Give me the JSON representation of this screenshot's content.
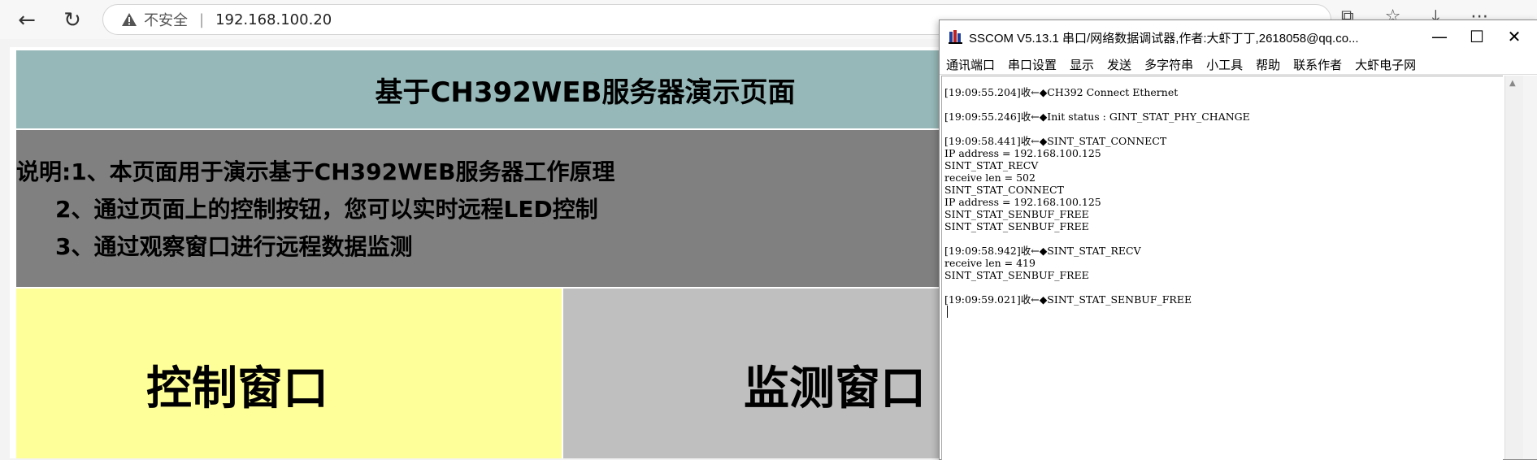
{
  "browser": {
    "back_icon": "←",
    "reload_icon": "↻",
    "insecure_label": "不安全",
    "url": "192.168.100.20"
  },
  "page": {
    "title": "基于CH392WEB服务器演示页面",
    "desc_lines": [
      "说明:1、本页面用于演示基于CH392WEB服务器工作原理",
      "2、通过页面上的控制按钮，您可以实时远程LED控制",
      "3、通过观察窗口进行远程数据监测"
    ],
    "control_title": "控制窗口",
    "monitor_title": "监测窗口",
    "colors": {
      "header": "#96b8b8",
      "desc": "#808080",
      "control": "#ffff99",
      "monitor": "#bfbfbf"
    }
  },
  "sscom": {
    "title": "SSCOM V5.13.1 串口/网络数据调试器,作者:大虾丁丁,2618058@qq.co...",
    "minimize": "—",
    "maximize": "☐",
    "close": "✕",
    "menu": [
      "通讯端口",
      "串口设置",
      "显示",
      "发送",
      "多字符串",
      "小工具",
      "帮助",
      "联系作者",
      "大虾电子网"
    ],
    "log": [
      [
        "[19:09:55.204]收←◆CH392 Connect Ethernet"
      ],
      [
        "[19:09:55.246]收←◆Init status : GINT_STAT_PHY_CHANGE"
      ],
      [
        "[19:09:58.441]收←◆SINT_STAT_CONNECT",
        "IP address = 192.168.100.125",
        "SINT_STAT_RECV",
        "receive len = 502",
        "SINT_STAT_CONNECT",
        "IP address = 192.168.100.125",
        "SINT_STAT_SENBUF_FREE",
        "SINT_STAT_SENBUF_FREE"
      ],
      [
        "[19:09:58.942]收←◆SINT_STAT_RECV",
        "receive len = 419",
        "SINT_STAT_SENBUF_FREE"
      ],
      [
        "[19:09:59.021]收←◆SINT_STAT_SENBUF_FREE"
      ]
    ]
  }
}
